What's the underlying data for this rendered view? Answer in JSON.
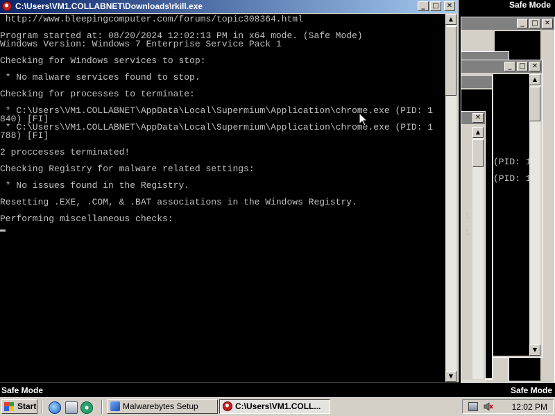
{
  "screen": {
    "safe_mode_label": "Safe Mode"
  },
  "window": {
    "title": "C:\\Users\\VM1.COLLABNET\\Downloads\\rkill.exe",
    "controls": {
      "minimize": "_",
      "maximize": "□",
      "close": "✕"
    }
  },
  "console": {
    "lines": [
      " http://www.bleepingcomputer.com/forums/topic308364.html",
      "",
      "Program started at: 08/20/2024 12:02:13 PM in x64 mode. (Safe Mode)",
      "Windows Version: Windows 7 Enterprise Service Pack 1",
      "",
      "Checking for Windows services to stop:",
      "",
      " * No malware services found to stop.",
      "",
      "Checking for processes to terminate:",
      "",
      " * C:\\Users\\VM1.COLLABNET\\AppData\\Local\\Supermium\\Application\\chrome.exe (PID: 1",
      "840) [FI]",
      " * C:\\Users\\VM1.COLLABNET\\AppData\\Local\\Supermium\\Application\\chrome.exe (PID: 1",
      "788) [FI]",
      "",
      "2 proccesses terminated!",
      "",
      "Checking Registry for malware related settings:",
      "",
      " * No issues found in the Registry.",
      "",
      "Resetting .EXE, .COM, & .BAT associations in the Windows Registry.",
      "",
      "Performing miscellaneous checks:"
    ]
  },
  "background_window": {
    "text_fragments": [
      "(PID: 1",
      "(PID: 1",
      "1",
      "1"
    ]
  },
  "taskbar": {
    "start_label": "Start",
    "tasks": [
      {
        "label": "Malwarebytes Setup",
        "active": false
      },
      {
        "label": "C:\\Users\\VM1.COLL...",
        "active": true
      }
    ],
    "clock": "12:02 PM"
  },
  "colors": {
    "title_active_start": "#0a246a",
    "title_active_end": "#a6caf0",
    "console_text": "#c0c0c0",
    "console_bg": "#000000",
    "chrome": "#d4d0c8"
  },
  "icons": {
    "window": "rkill-app-icon",
    "start": "windows-flag-icon",
    "quick_launch": [
      "internet-explorer-icon",
      "windows-explorer-icon",
      "media-player-icon"
    ],
    "tray": [
      "network-icon",
      "volume-muted-icon"
    ]
  }
}
